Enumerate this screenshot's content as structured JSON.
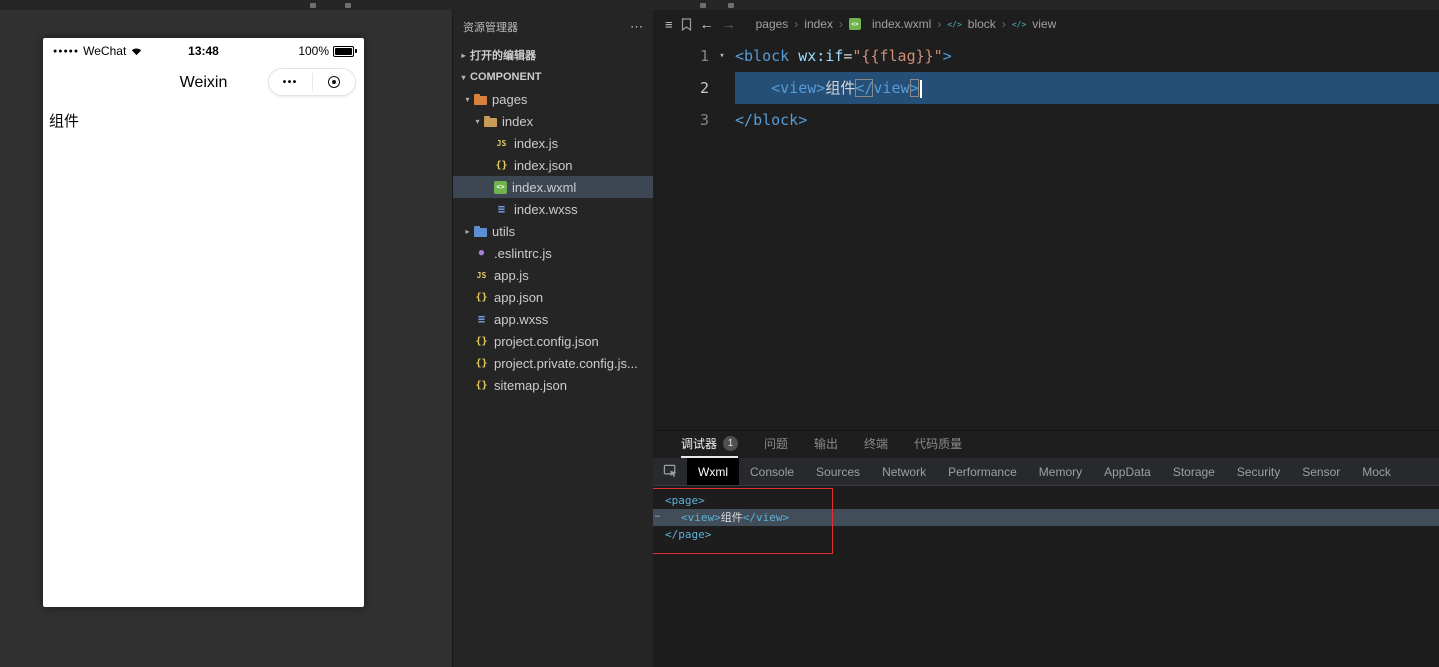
{
  "simulator": {
    "status": {
      "signal_dots": "●●●●●",
      "carrier": "WeChat",
      "time": "13:48",
      "battery_pct": "100%"
    },
    "nav_title": "Weixin",
    "capsule": {
      "menu": "•••"
    },
    "page_text": "组件"
  },
  "explorer": {
    "title": "资源管理器",
    "more": "⋯",
    "sections": {
      "open_editors": "打开的编辑器",
      "project": "COMPONENT"
    },
    "files": [
      {
        "label": "pages",
        "icon": "folder-pages",
        "indent": 0,
        "arrow": "down"
      },
      {
        "label": "index",
        "icon": "folder",
        "indent": 1,
        "arrow": "down"
      },
      {
        "label": "index.js",
        "icon": "js",
        "indent": 2
      },
      {
        "label": "index.json",
        "icon": "json",
        "indent": 2
      },
      {
        "label": "index.wxml",
        "icon": "wxml",
        "indent": 2,
        "selected": true
      },
      {
        "label": "index.wxss",
        "icon": "wxss",
        "indent": 2
      },
      {
        "label": "utils",
        "icon": "folder-utils",
        "indent": 0,
        "arrow": "right"
      },
      {
        "label": ".eslintrc.js",
        "icon": "eslint",
        "indent": 0
      },
      {
        "label": "app.js",
        "icon": "js",
        "indent": 0
      },
      {
        "label": "app.json",
        "icon": "json",
        "indent": 0
      },
      {
        "label": "app.wxss",
        "icon": "wxss",
        "indent": 0
      },
      {
        "label": "project.config.json",
        "icon": "json",
        "indent": 0
      },
      {
        "label": "project.private.config.js...",
        "icon": "json",
        "indent": 0
      },
      {
        "label": "sitemap.json",
        "icon": "json",
        "indent": 0
      }
    ]
  },
  "editor": {
    "breadcrumb": [
      {
        "label": "pages"
      },
      {
        "label": "index"
      },
      {
        "label": "index.wxml",
        "icon": "wxml"
      },
      {
        "label": "block",
        "icon": "tag"
      },
      {
        "label": "view",
        "icon": "tag"
      }
    ],
    "code_lines": [
      {
        "num": "1",
        "fold": true,
        "segments": [
          [
            "p",
            "<"
          ],
          [
            "t",
            "block"
          ],
          [
            "d",
            " "
          ],
          [
            "a",
            "wx:if"
          ],
          [
            "d",
            "="
          ],
          [
            "s",
            "\"{{flag}}\""
          ],
          [
            "p",
            ">"
          ]
        ]
      },
      {
        "num": "2",
        "current": true,
        "segments": [
          [
            "d",
            "    "
          ],
          [
            "p",
            "<"
          ],
          [
            "t",
            "view"
          ],
          [
            "p",
            ">"
          ],
          [
            "x",
            "组件"
          ],
          [
            "m",
            "</"
          ],
          [
            "t",
            "view"
          ],
          [
            "m",
            ">"
          ]
        ]
      },
      {
        "num": "3",
        "segments": [
          [
            "p",
            "</"
          ],
          [
            "t",
            "block"
          ],
          [
            "p",
            ">"
          ]
        ]
      }
    ]
  },
  "debug_panel": {
    "tabs": [
      {
        "label": "调试器",
        "badge": "1",
        "active": true
      },
      {
        "label": "问题"
      },
      {
        "label": "输出"
      },
      {
        "label": "终端"
      },
      {
        "label": "代码质量"
      }
    ],
    "devtools_tabs": [
      {
        "label": "Wxml",
        "active": true
      },
      {
        "label": "Console"
      },
      {
        "label": "Sources"
      },
      {
        "label": "Network"
      },
      {
        "label": "Performance"
      },
      {
        "label": "Memory"
      },
      {
        "label": "AppData"
      },
      {
        "label": "Storage"
      },
      {
        "label": "Security"
      },
      {
        "label": "Sensor"
      },
      {
        "label": "Mock"
      }
    ],
    "wxml_rows": [
      {
        "indent": 0,
        "segments": [
          [
            "wt",
            "<page>"
          ]
        ]
      },
      {
        "indent": 1,
        "gutter": "⋯",
        "selected": true,
        "segments": [
          [
            "wt",
            "<view>"
          ],
          [
            "wx",
            "组件"
          ],
          [
            "wt",
            "</view>"
          ]
        ]
      },
      {
        "indent": 0,
        "segments": [
          [
            "wt",
            "</page>"
          ]
        ]
      }
    ]
  }
}
